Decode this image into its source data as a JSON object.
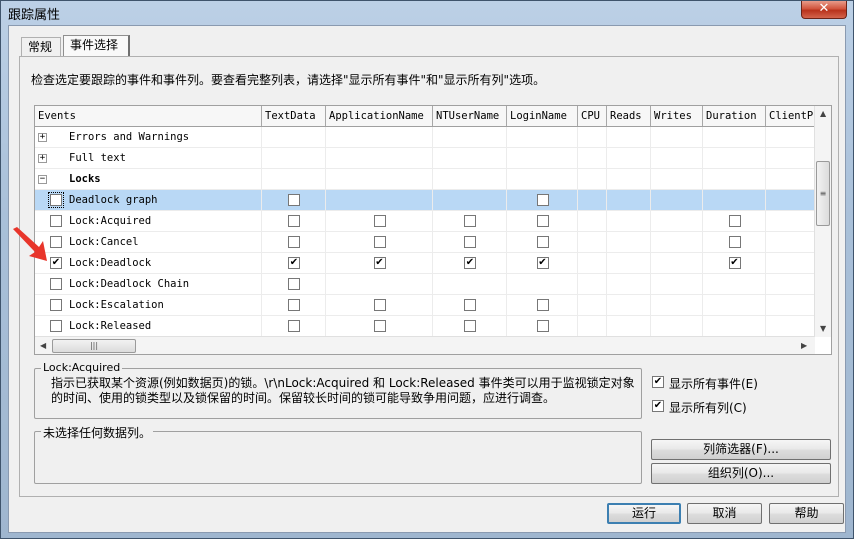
{
  "window": {
    "title": "跟踪属性",
    "close_icon": "close-icon"
  },
  "tabs": [
    {
      "label": "常规",
      "active": false
    },
    {
      "label": "事件选择",
      "active": true
    }
  ],
  "instruction": "检查选定要跟踪的事件和事件列。要查看完整列表，请选择\"显示所有事件\"和\"显示所有列\"选项。",
  "grid": {
    "columns": [
      "Events",
      "TextData",
      "ApplicationName",
      "NTUserName",
      "LoginName",
      "CPU",
      "Reads",
      "Writes",
      "Duration",
      "ClientP"
    ],
    "rows": [
      {
        "type": "category",
        "label": "Errors and Warnings",
        "expander": "+",
        "bold": false
      },
      {
        "type": "category",
        "label": "Full text",
        "expander": "+",
        "bold": false
      },
      {
        "type": "category",
        "label": "Locks",
        "expander": "−",
        "bold": true
      },
      {
        "type": "event",
        "label": "Deadlock graph",
        "checked": false,
        "selected": true,
        "cells": {
          "TextData": "unchecked",
          "LoginName": "unchecked"
        }
      },
      {
        "type": "event",
        "label": "Lock:Acquired",
        "checked": false,
        "cells": {
          "TextData": "unchecked",
          "ApplicationName": "unchecked",
          "NTUserName": "unchecked",
          "LoginName": "unchecked",
          "Duration": "unchecked"
        }
      },
      {
        "type": "event",
        "label": "Lock:Cancel",
        "checked": false,
        "cells": {
          "TextData": "unchecked",
          "ApplicationName": "unchecked",
          "NTUserName": "unchecked",
          "LoginName": "unchecked",
          "Duration": "unchecked"
        }
      },
      {
        "type": "event",
        "label": "Lock:Deadlock",
        "checked": true,
        "cells": {
          "TextData": "checked",
          "ApplicationName": "checked",
          "NTUserName": "checked",
          "LoginName": "checked",
          "Duration": "checked"
        }
      },
      {
        "type": "event",
        "label": "Lock:Deadlock Chain",
        "checked": false,
        "cells": {
          "TextData": "unchecked"
        }
      },
      {
        "type": "event",
        "label": "Lock:Escalation",
        "checked": false,
        "cells": {
          "TextData": "unchecked",
          "ApplicationName": "unchecked",
          "NTUserName": "unchecked",
          "LoginName": "unchecked"
        }
      },
      {
        "type": "event",
        "label": "Lock:Released",
        "checked": false,
        "cells": {
          "TextData": "unchecked",
          "ApplicationName": "unchecked",
          "NTUserName": "unchecked",
          "LoginName": "unchecked"
        }
      }
    ],
    "hscroll_thumb_icon": "grip-icon",
    "vscroll_thumb_icon": "grip-icon"
  },
  "description": {
    "title": "Lock:Acquired",
    "text": "指示已获取某个资源(例如数据页)的锁。\\r\\nLock:Acquired 和 Lock:Released 事件类可以用于监视锁定对象的时间、使用的锁类型以及锁保留的时间。保留较长时间的锁可能导致争用问题，应进行调查。"
  },
  "column_info": {
    "title": "未选择任何数据列。"
  },
  "options": {
    "show_all_events": {
      "label": "显示所有事件(E)",
      "checked": true
    },
    "show_all_columns": {
      "label": "显示所有列(C)",
      "checked": true
    }
  },
  "buttons": {
    "column_filters": "列筛选器(F)...",
    "organize_columns": "组织列(O)...",
    "run": "运行",
    "cancel": "取消",
    "help": "帮助"
  },
  "annotation": {
    "arrow_color": "#e8352b"
  }
}
